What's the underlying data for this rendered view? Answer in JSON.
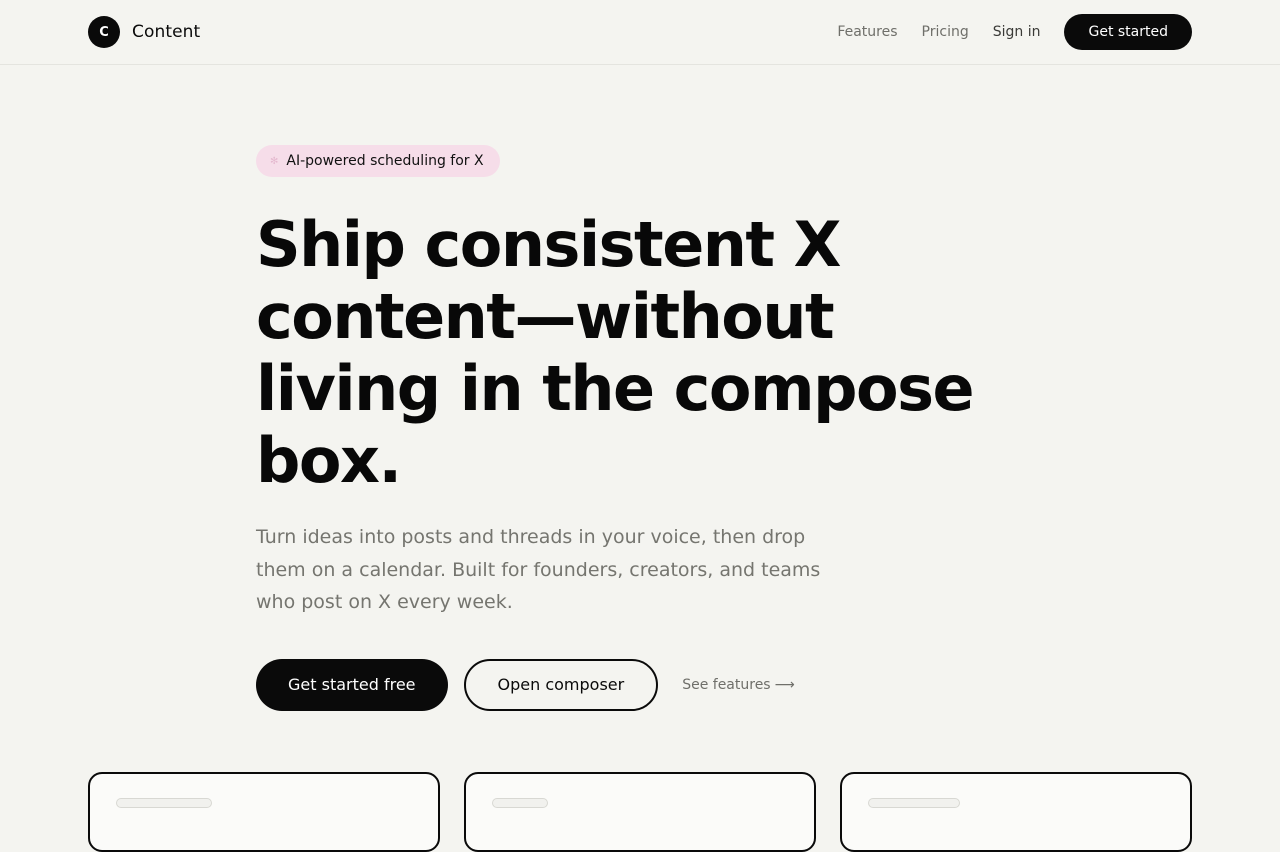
{
  "brand": {
    "mark": "C",
    "name": "Content"
  },
  "nav": {
    "features": "Features",
    "pricing": "Pricing",
    "signin": "Sign in",
    "cta": "Get started"
  },
  "hero": {
    "badge": "AI-powered scheduling for X",
    "badge_icon": "sparkle-icon",
    "headline": "Ship consistent X content—without living in the compose box.",
    "subhead": "Turn ideas into posts and threads in your voice, then drop them on a calendar. Built for founders, creators, and teams who post on X every week.",
    "cta_primary": "Get started free",
    "cta_secondary": "Open composer",
    "cta_link": "See features",
    "cta_link_arrow": "⟶"
  },
  "colors": {
    "background": "#f4f4f0",
    "primary": "#0a0a0a",
    "badge_bg": "#f6dde9",
    "muted_text": "#75756f"
  }
}
